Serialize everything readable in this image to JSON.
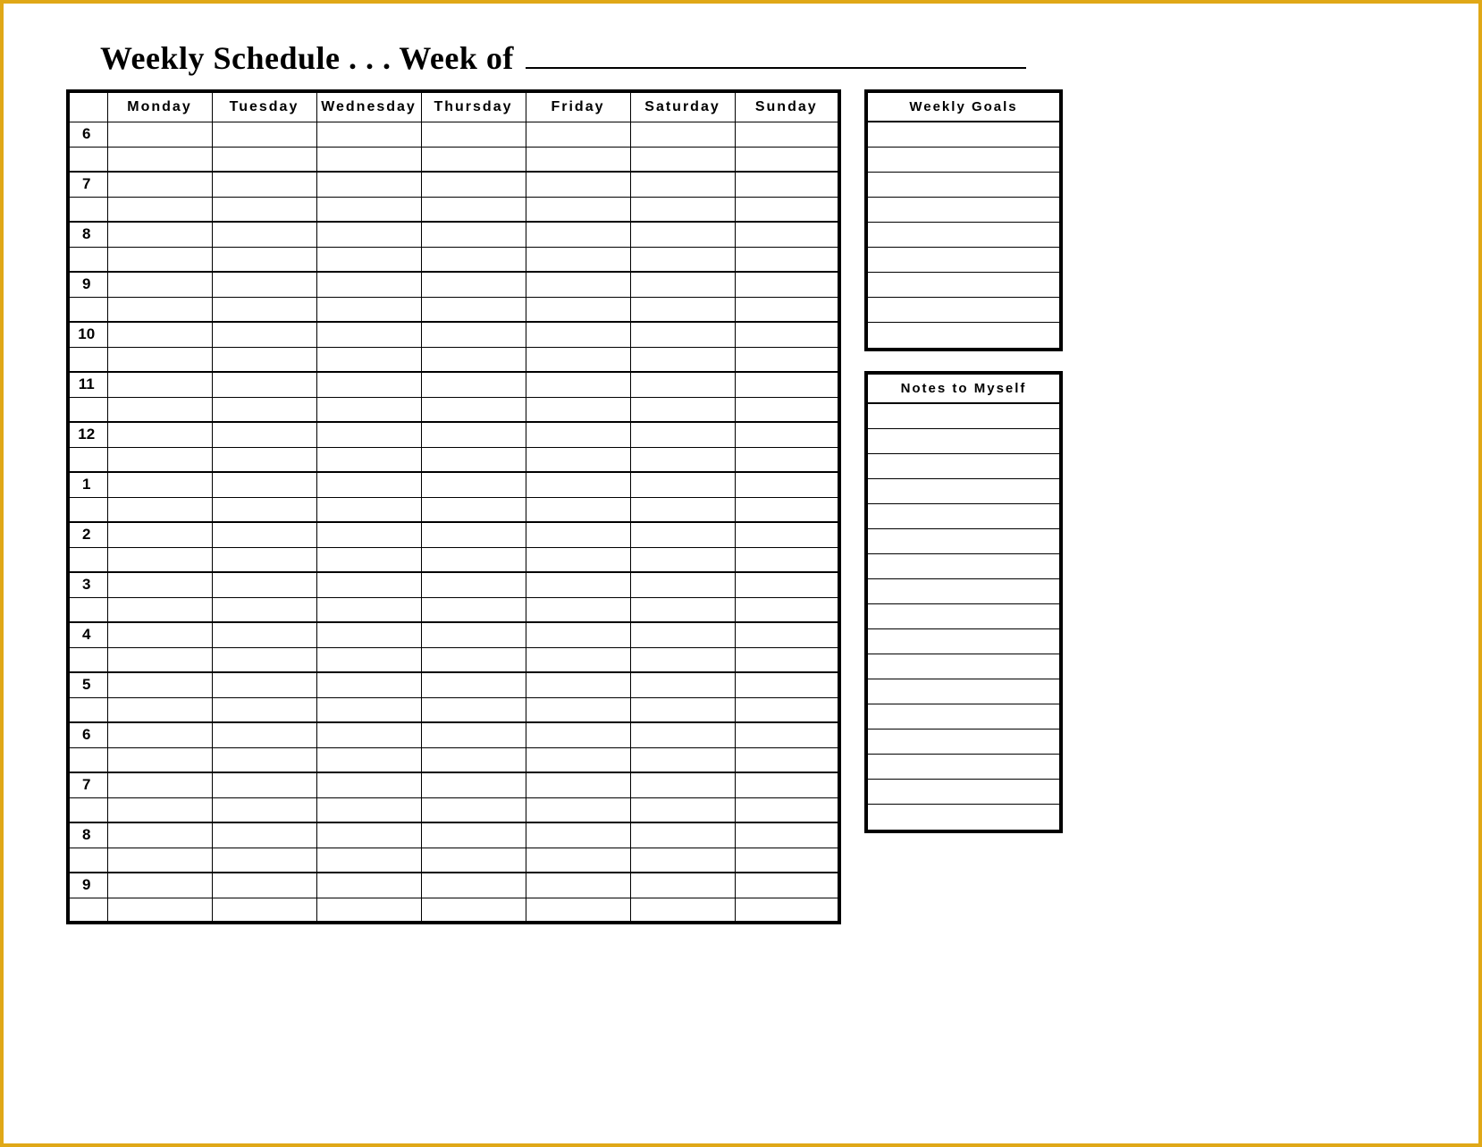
{
  "title": {
    "prefix": "Weekly Schedule . . . Week of",
    "week_of_value": ""
  },
  "schedule": {
    "days": [
      "Monday",
      "Tuesday",
      "Wednesday",
      "Thursday",
      "Friday",
      "Saturday",
      "Sunday"
    ],
    "hours": [
      "6",
      "7",
      "8",
      "9",
      "10",
      "11",
      "12",
      "1",
      "2",
      "3",
      "4",
      "5",
      "6",
      "7",
      "8",
      "9"
    ]
  },
  "sidebar": {
    "goals_title": "Weekly Goals",
    "goals_lines": 9,
    "notes_title": "Notes to Myself",
    "notes_lines": 17
  }
}
